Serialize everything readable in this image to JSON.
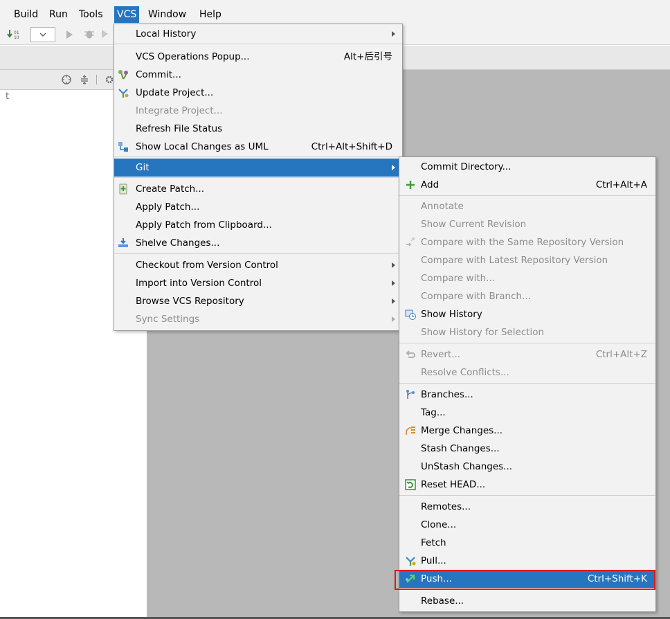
{
  "menubar": {
    "build": "Build",
    "run": "Run",
    "tools": "Tools",
    "vcs": "VCS",
    "window": "Window",
    "help": "Help"
  },
  "panel": {
    "fragment": "t"
  },
  "vcs_menu": {
    "local_history": "Local History",
    "vcs_operations_popup": "VCS Operations Popup...",
    "vcs_operations_popup_shortcut": "Alt+后引号",
    "commit": "Commit...",
    "update_project": "Update Project...",
    "integrate_project": "Integrate Project...",
    "refresh_file_status": "Refresh File Status",
    "show_local_changes_uml": "Show Local Changes as UML",
    "show_local_changes_uml_shortcut": "Ctrl+Alt+Shift+D",
    "git": "Git",
    "create_patch": "Create Patch...",
    "apply_patch": "Apply Patch...",
    "apply_patch_clipboard": "Apply Patch from Clipboard...",
    "shelve_changes": "Shelve Changes...",
    "checkout_vc": "Checkout from Version Control",
    "import_vc": "Import into Version Control",
    "browse_repo": "Browse VCS Repository",
    "sync_settings": "Sync Settings"
  },
  "git_menu": {
    "commit_directory": "Commit Directory...",
    "add": "Add",
    "add_shortcut": "Ctrl+Alt+A",
    "annotate": "Annotate",
    "show_current_revision": "Show Current Revision",
    "compare_same_repo": "Compare with the Same Repository Version",
    "compare_latest_repo": "Compare with Latest Repository Version",
    "compare_with": "Compare with...",
    "compare_branch": "Compare with Branch...",
    "show_history": "Show History",
    "show_history_selection": "Show History for Selection",
    "revert": "Revert...",
    "revert_shortcut": "Ctrl+Alt+Z",
    "resolve_conflicts": "Resolve Conflicts...",
    "branches": "Branches...",
    "tag": "Tag...",
    "merge_changes": "Merge Changes...",
    "stash_changes": "Stash Changes...",
    "unstash_changes": "UnStash Changes...",
    "reset_head": "Reset HEAD...",
    "remotes": "Remotes...",
    "clone": "Clone...",
    "fetch": "Fetch",
    "pull": "Pull...",
    "push": "Push...",
    "push_shortcut": "Ctrl+Shift+K",
    "rebase": "Rebase..."
  },
  "colors": {
    "selection": "#2675bf",
    "highlight_box": "#e01818"
  }
}
